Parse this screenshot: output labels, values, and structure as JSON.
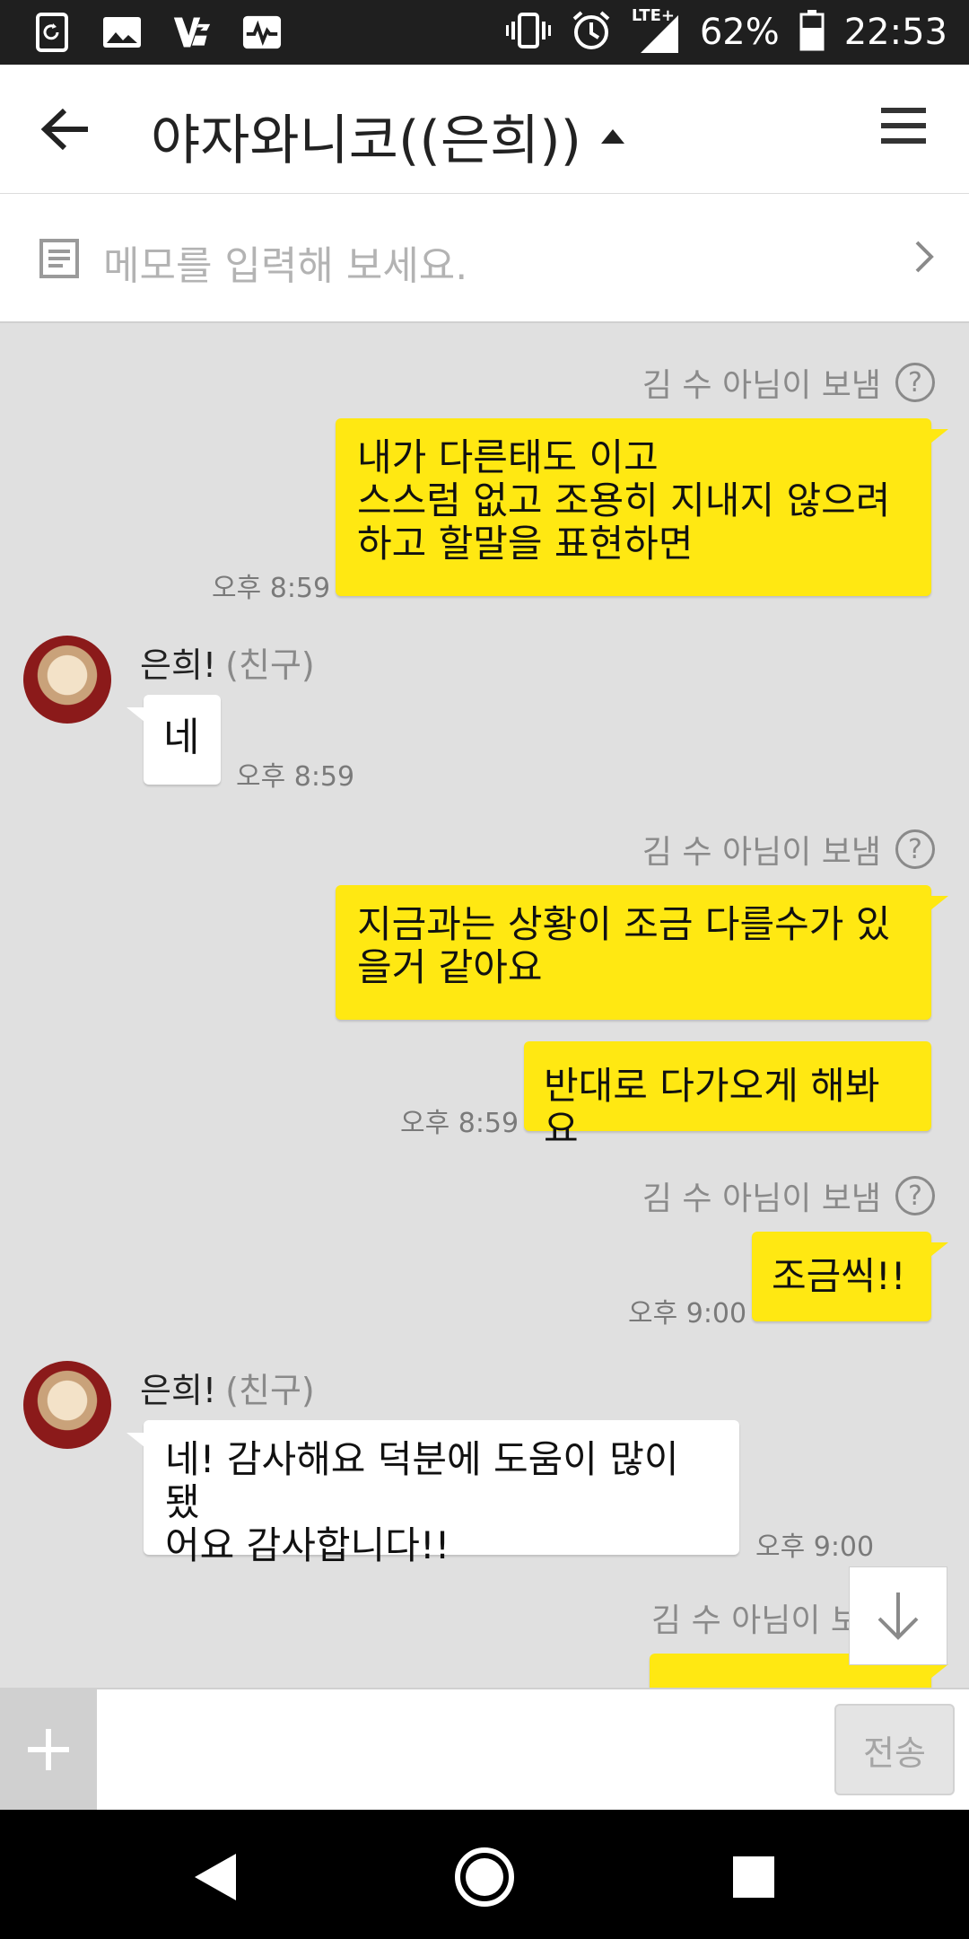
{
  "status_bar": {
    "icons_left": [
      "refresh-app-icon",
      "image-icon",
      "v-app-icon",
      "activity-icon"
    ],
    "network": "LTE+",
    "battery": "62%",
    "clock": "22:53"
  },
  "header": {
    "title": "야자와니코((은희))"
  },
  "memo": {
    "placeholder": "메모를 입력해 보세요."
  },
  "messages": {
    "sender_label": "김 수 아님이 보냄",
    "help_mark": "?",
    "friend_name": "은희!",
    "friend_tag": "(친구)",
    "m1": {
      "text": "내가 다른태도 이고\n스스럼 없고 조용히 지내지 않으려\n하고 할말을 표현하면",
      "time": "오후 8:59"
    },
    "m2": {
      "text": "네",
      "time": "오후 8:59"
    },
    "m3": {
      "text": "지금과는 상황이 조금 다를수가 있\n을거 같아요"
    },
    "m4": {
      "text": "반대로 다가오게 해봐요",
      "time": "오후 8:59"
    },
    "m5": {
      "text": "조금씩!!",
      "time": "오후 9:00"
    },
    "m6": {
      "text": "네! 감사해요 덕분에 도움이 많이 됐\n어요 감사합니다!!",
      "time": "오후 9:00"
    },
    "m7_partial": {
      "sender": "김 수 아님이 보"
    }
  },
  "input_bar": {
    "plus": "+",
    "send": "전송"
  }
}
